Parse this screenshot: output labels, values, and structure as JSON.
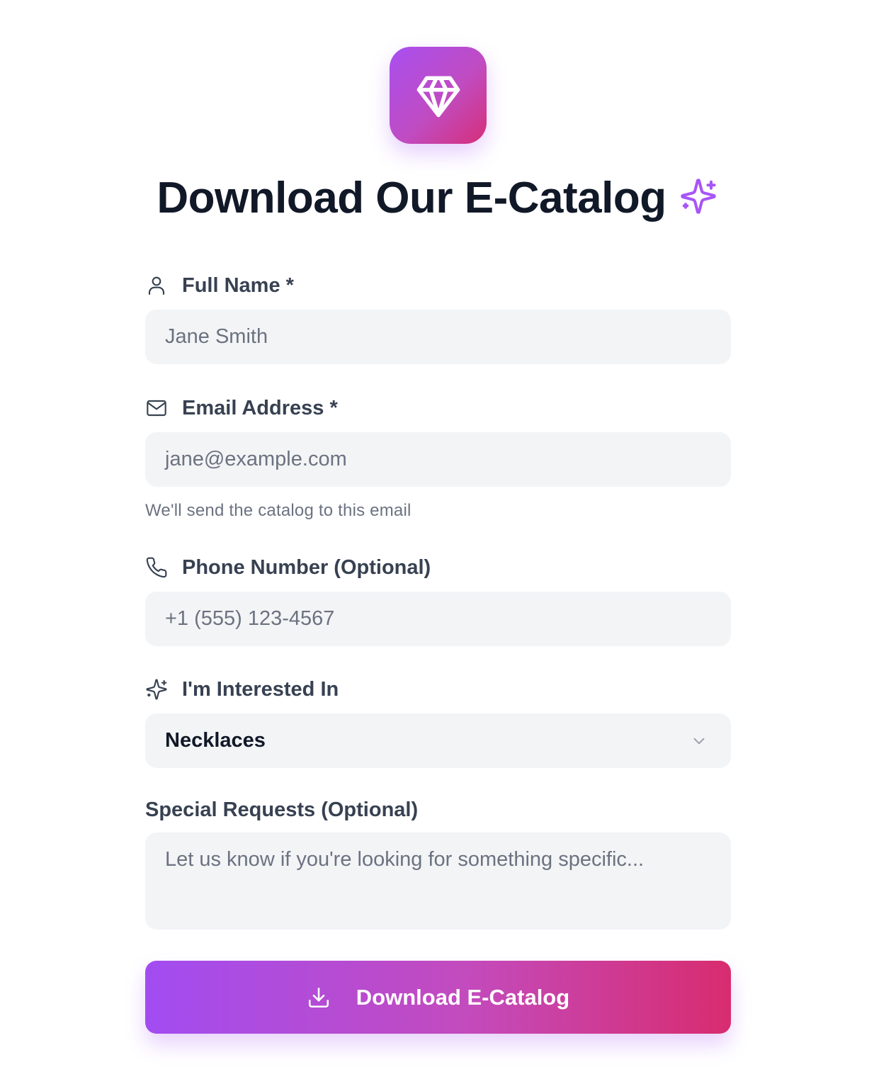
{
  "header": {
    "logo_icon": "gem-icon",
    "title": "Download Our E-Catalog",
    "title_icon": "sparkles-icon"
  },
  "form": {
    "full_name": {
      "label": "Full Name *",
      "icon": "user-icon",
      "placeholder": "Jane Smith"
    },
    "email": {
      "label": "Email Address *",
      "icon": "mail-icon",
      "placeholder": "jane@example.com",
      "help": "We'll send the catalog to this email"
    },
    "phone": {
      "label": "Phone Number (Optional)",
      "icon": "phone-icon",
      "placeholder": "+1 (555) 123-4567"
    },
    "interest": {
      "label": "I'm Interested In",
      "icon": "sparkles-icon",
      "selected": "Necklaces"
    },
    "requests": {
      "label": "Special Requests (Optional)",
      "placeholder": "Let us know if you're looking for something specific..."
    },
    "submit": {
      "label": "Download E-Catalog",
      "icon": "download-icon"
    }
  },
  "colors": {
    "accent_purple": "#a855f7",
    "accent_pink": "#db2777",
    "field_bg": "#f3f4f6",
    "heading": "#111827",
    "label": "#374151",
    "muted": "#6b7280"
  }
}
